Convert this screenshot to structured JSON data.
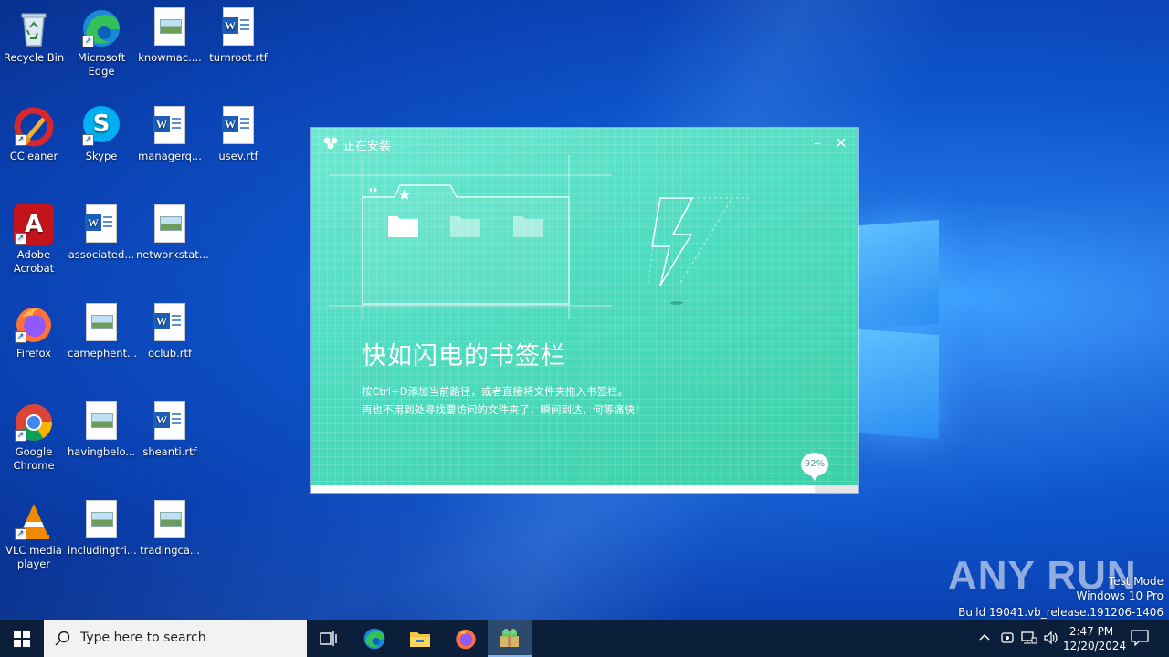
{
  "desktop": {
    "icons": [
      {
        "label": "Recycle Bin"
      },
      {
        "label": "Microsoft Edge"
      },
      {
        "label": "knowmac...."
      },
      {
        "label": "turnroot.rtf"
      },
      {
        "label": "CCleaner"
      },
      {
        "label": "Skype"
      },
      {
        "label": "managerq..."
      },
      {
        "label": "usev.rtf"
      },
      {
        "label": "Adobe Acrobat"
      },
      {
        "label": "associated..."
      },
      {
        "label": "networkstat..."
      },
      {
        "label": "Firefox"
      },
      {
        "label": "camephent..."
      },
      {
        "label": "oclub.rtf"
      },
      {
        "label": "Google Chrome"
      },
      {
        "label": "havingbelo..."
      },
      {
        "label": "sheanti.rtf"
      },
      {
        "label": "VLC media player"
      },
      {
        "label": "includingtri..."
      },
      {
        "label": "tradingca..."
      }
    ]
  },
  "installer": {
    "title": "正在安装",
    "minimize": "–",
    "close": "✕",
    "headline": "快如闪电的书签栏",
    "desc_line1": "按Ctrl+D添加当前路径，或者直接将文件夹拖入书签栏。",
    "desc_line2": "再也不用到处寻找要访问的文件夹了，瞬间到达，何等痛快！",
    "progress_percent": 92,
    "progress_label": "92%",
    "accent": "#4fdcc0"
  },
  "taskbar": {
    "search_placeholder": "Type here to search",
    "time": "2:47 PM",
    "date": "12/20/2024"
  },
  "watermark": {
    "brand": "ANY RUN",
    "line1": "Test Mode",
    "line2": "Windows 10 Pro",
    "line3": "Build 19041.vb_release.191206-1406"
  }
}
